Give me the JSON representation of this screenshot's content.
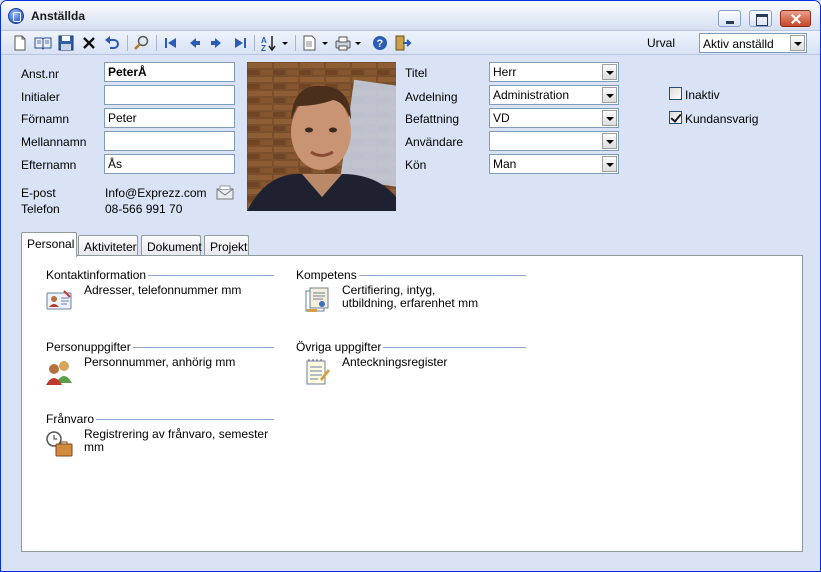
{
  "window": {
    "title": "Anställda",
    "controls": [
      "minimize",
      "maximize",
      "close"
    ]
  },
  "toolbar": {
    "buttons": [
      "new-document-icon",
      "open-book-icon",
      "save-icon",
      "delete-icon",
      "undo-icon",
      "search-icon",
      "first-record-icon",
      "previous-record-icon",
      "next-record-icon",
      "last-record-icon",
      "sort-icon",
      "report-icon",
      "print-icon",
      "help-icon",
      "exit-icon"
    ],
    "urval_label": "Urval",
    "urval_value": "Aktiv anställd"
  },
  "fields": {
    "anst_nr_label": "Anst.nr",
    "anst_nr_value": "PeterÅ",
    "initialer_label": "Initialer",
    "initialer_value": "",
    "fornamn_label": "Förnamn",
    "fornamn_value": "Peter",
    "mellannamn_label": "Mellannamn",
    "mellannamn_value": "",
    "efternamn_label": "Efternamn",
    "efternamn_value": "Ås",
    "epost_label": "E-post",
    "epost_value": "Info@Exprezz.com",
    "telefon_label": "Telefon",
    "telefon_value": "08-566 991 70",
    "titel_label": "Titel",
    "titel_value": "Herr",
    "avdelning_label": "Avdelning",
    "avdelning_value": "Administration",
    "befattning_label": "Befattning",
    "befattning_value": "VD",
    "anvandare_label": "Användare",
    "anvandare_value": "",
    "kon_label": "Kön",
    "kon_value": "Man",
    "inaktiv_label": "Inaktiv",
    "inaktiv_checked": false,
    "kundansvarig_label": "Kundansvarig",
    "kundansvarig_checked": true
  },
  "tabs": [
    {
      "label": "Personal",
      "active": true
    },
    {
      "label": "Aktiviteter",
      "active": false
    },
    {
      "label": "Dokument",
      "active": false
    },
    {
      "label": "Projekt",
      "active": false
    }
  ],
  "groups": [
    {
      "title": "Kontaktinformation",
      "description": "Adresser, telefonnummer mm",
      "icon": "contact-card-icon"
    },
    {
      "title": "Kompetens",
      "description": "Certifiering, intyg, utbildning, erfarenhet mm",
      "icon": "certificate-icon"
    },
    {
      "title": "Personuppgifter",
      "description": "Personnummer, anhörig mm",
      "icon": "people-icon"
    },
    {
      "title": "Övriga uppgifter",
      "description": "Anteckningsregister",
      "icon": "notepad-icon"
    },
    {
      "title": "Frånvaro",
      "description": "Registrering av frånvaro, semester mm",
      "icon": "clock-briefcase-icon"
    }
  ]
}
